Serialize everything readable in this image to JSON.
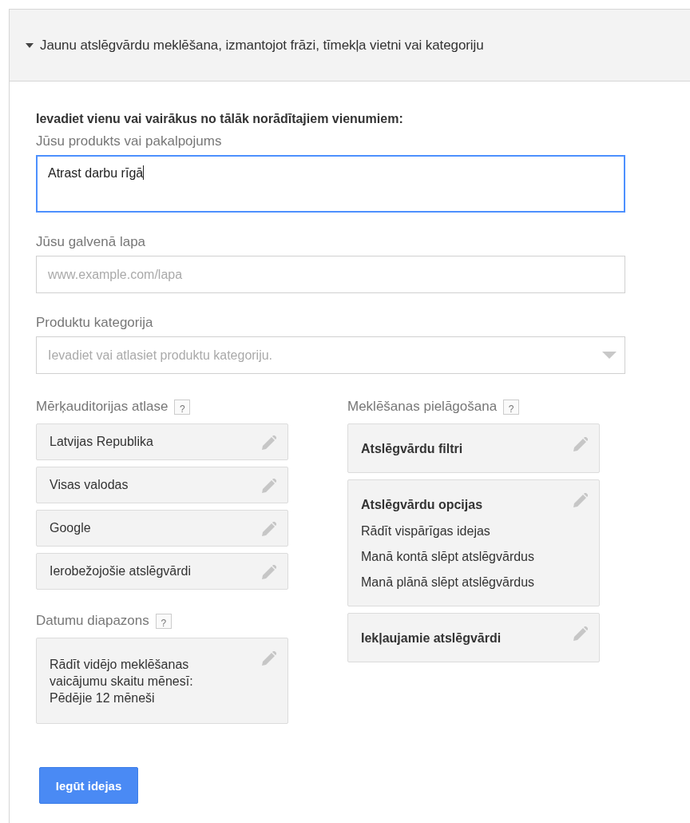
{
  "panel": {
    "title": "Jaunu atslēgvārdu meklēšana, izmantojot frāzi, tīmekļa vietni vai kategoriju",
    "expanded": true
  },
  "instruction": "Ievadiet vienu vai vairākus no tālāk norādītajiem vienumiem:",
  "fields": [
    {
      "kind": "textarea",
      "label": "Jūsu produkts vai pakalpojums",
      "value": "Atrast darbu rīgā",
      "focused": true
    },
    {
      "kind": "text",
      "label": "Jūsu galvenā lapa",
      "placeholder": "www.example.com/lapa",
      "focused": false
    },
    {
      "kind": "select",
      "label": "Produktu kategorija",
      "placeholder": "Ievadiet vai atlasiet produktu kategoriju.",
      "focused": false
    }
  ],
  "targeting": {
    "label": "Mērķauditorijas atlase",
    "help": "?",
    "items": [
      "Latvijas Republika",
      "Visas valodas",
      "Google",
      "Ierobežojošie atslēgvārdi"
    ]
  },
  "date_range": {
    "label": "Datumu diapazons",
    "help": "?",
    "lines": [
      "Rādīt vidējo meklēšanas",
      "vaicājumu skaitu mēnesī:",
      "Pēdējie 12 mēneši"
    ]
  },
  "customize": {
    "label": "Meklēšanas pielāgošana",
    "help": "?",
    "cards": [
      {
        "title": "Atslēgvārdu filtri"
      },
      {
        "title": "Atslēgvārdu opcijas",
        "lines": [
          "Rādīt vispārīgas idejas",
          "Manā kontā slēpt atslēgvārdus",
          "Manā plānā slēpt atslēgvārdus"
        ]
      },
      {
        "title": "Iekļaujamie atslēgvārdi"
      }
    ]
  },
  "submit": "Iegūt idejas"
}
